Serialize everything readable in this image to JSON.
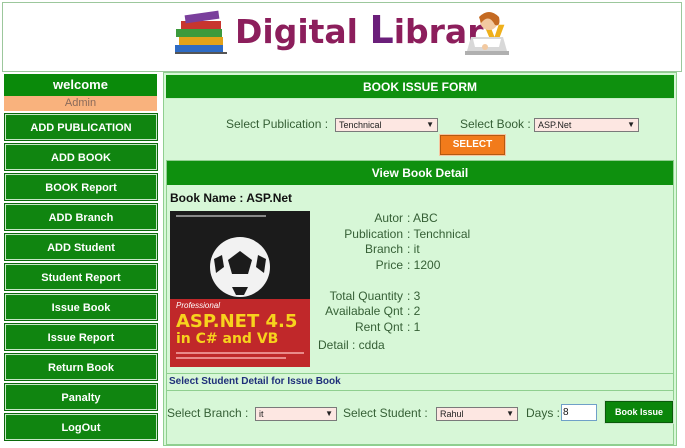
{
  "header": {
    "logo_text_1": "Digital",
    "logo_text_2": "L",
    "logo_text_3": "ibrar",
    "logo_text_4": "y"
  },
  "sidebar": {
    "welcome": "welcome",
    "user": "Admin",
    "items": [
      {
        "label": "ADD PUBLICATION"
      },
      {
        "label": "ADD BOOK"
      },
      {
        "label": "BOOK Report"
      },
      {
        "label": "ADD Branch"
      },
      {
        "label": "ADD Student"
      },
      {
        "label": "Student Report"
      },
      {
        "label": "Issue Book"
      },
      {
        "label": "Issue Report"
      },
      {
        "label": "Return Book"
      },
      {
        "label": "Panalty"
      },
      {
        "label": "LogOut"
      }
    ]
  },
  "form": {
    "title": "BOOK ISSUE FORM",
    "publication_label": "Select Publication :",
    "publication_value": "Tenchnical",
    "book_label": "Select Book :",
    "book_value": "ASP.Net",
    "select_button": "SELECT"
  },
  "detail": {
    "title": "View Book Detail",
    "book_name": "Book Name : ASP.Net",
    "cover": {
      "line1": "Professional",
      "line2": "ASP.NET 4.5",
      "line3": "in C# and VB"
    },
    "rows": [
      {
        "key": "Autor",
        "value": ": ABC"
      },
      {
        "key": "Publication",
        "value": ": Tenchnical"
      },
      {
        "key": "Branch",
        "value": ": it"
      },
      {
        "key": "Price",
        "value": ": 1200"
      },
      {
        "key": "Total Quantity",
        "value": ": 3"
      },
      {
        "key": "Availabale Qnt",
        "value": ": 2"
      },
      {
        "key": "Rent Qnt",
        "value": ": 1"
      }
    ],
    "detail_line": "Detail : cdda"
  },
  "student": {
    "heading": "Select Student Detail for Issue Book",
    "branch_label": "Select Branch :",
    "branch_value": "it",
    "student_label": "Select Student :",
    "student_value": "Rahul",
    "days_label": "Days :",
    "days_value": "8",
    "issue_button": "Book Issue"
  },
  "colors": {
    "accent_green": "#0e900e",
    "panel_bg": "#d7f7d7",
    "select_button": "#f27b1b",
    "user_bar": "#f9b27d"
  }
}
